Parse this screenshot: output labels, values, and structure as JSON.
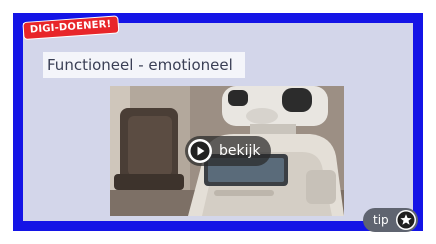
{
  "badge": {
    "label": "DIGI-DOENER!"
  },
  "title": {
    "text": "Functioneel - emotioneel"
  },
  "video": {
    "play_label": "bekijk",
    "thumbnail_icon": "robot-image",
    "play_icon": "play-icon"
  },
  "tip": {
    "label": "tip",
    "icon": "star-icon"
  },
  "colors": {
    "frame": "#1414e6",
    "background": "#d3d6ea",
    "badge": "#e8262a"
  }
}
